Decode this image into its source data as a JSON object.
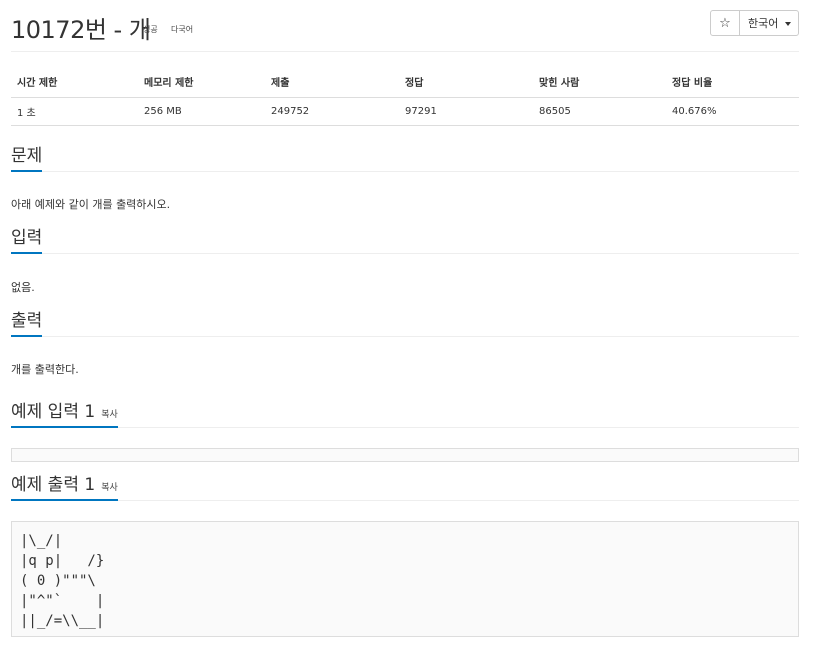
{
  "header": {
    "title": "10172번 - 개",
    "tags": [
      "성공",
      "다국어"
    ],
    "star_glyph": "☆",
    "language": "한국어"
  },
  "info_table": {
    "headers": [
      "시간 제한",
      "메모리 제한",
      "제출",
      "정답",
      "맞힌 사람",
      "정답 비율"
    ],
    "values": [
      "1 초",
      "256 MB",
      "249752",
      "97291",
      "86505",
      "40.676%"
    ]
  },
  "sections": {
    "problem": {
      "title": "문제",
      "text": "아래 예제와 같이 개를 출력하시오."
    },
    "input": {
      "title": "입력",
      "text": "없음."
    },
    "output": {
      "title": "출력",
      "text": "개를 출력한다."
    },
    "sample_input": {
      "title": "예제 입력 1",
      "copy_label": "복사",
      "content": ""
    },
    "sample_output": {
      "title": "예제 출력 1",
      "copy_label": "복사",
      "content": "|\\_/|\n|q p|   /}\n( 0 )\"\"\"\\\n|\"^\"`    |\n||_/=\\\\__|"
    }
  },
  "colors": {
    "accent": "#0076c0",
    "border": "#dddddd",
    "text": "#333333"
  }
}
